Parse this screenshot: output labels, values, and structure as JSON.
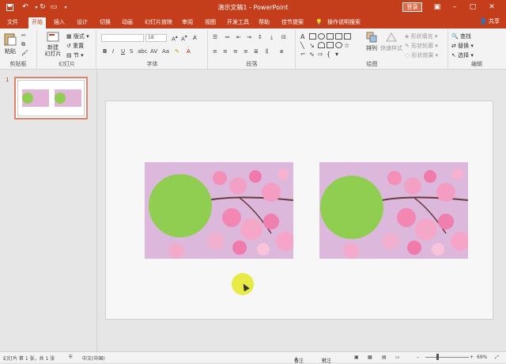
{
  "window": {
    "title": "演示文稿1 - PowerPoint",
    "login_label": "登录"
  },
  "tabs": [
    {
      "label": "文件"
    },
    {
      "label": "开始"
    },
    {
      "label": "插入"
    },
    {
      "label": "设计"
    },
    {
      "label": "切换"
    },
    {
      "label": "动画"
    },
    {
      "label": "幻灯片放映"
    },
    {
      "label": "审阅"
    },
    {
      "label": "视图"
    },
    {
      "label": "开发工具"
    },
    {
      "label": "帮助"
    },
    {
      "label": "佳节提案"
    },
    {
      "label": "操作说明搜索"
    }
  ],
  "share_label": "共享",
  "ribbon": {
    "clipboard": {
      "label": "剪贴板",
      "paste": "粘贴"
    },
    "slides": {
      "label": "幻灯片",
      "new_slide": "新建\n幻灯片",
      "layout": "版式",
      "reset": "重置",
      "section": "节"
    },
    "font": {
      "label": "字体",
      "font_size": "18"
    },
    "paragraph": {
      "label": "段落"
    },
    "drawing": {
      "label": "绘图",
      "arrange": "排列",
      "quick_styles": "快速样式",
      "shape_fill": "形状填充",
      "shape_outline": "形状轮廓",
      "shape_effects": "形状效果"
    },
    "editing": {
      "label": "编辑",
      "find": "查找",
      "replace": "替换",
      "select": "选择"
    }
  },
  "thumbnail": {
    "number": "1"
  },
  "status": {
    "slide_info": "幻灯片 第 1 张，共 1 张",
    "language": "中文(中国)",
    "notes": "备注",
    "comments": "批注",
    "zoom": "69%"
  },
  "colors": {
    "accent": "#c43e1c",
    "circle": "#8fce50"
  }
}
